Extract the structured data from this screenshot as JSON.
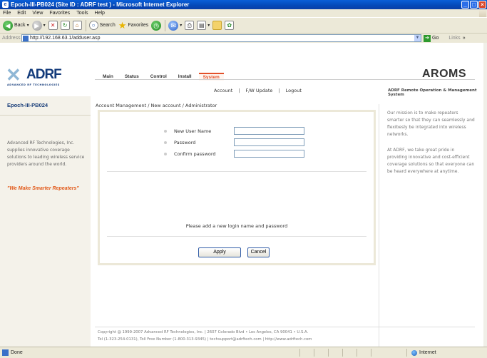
{
  "window": {
    "title": "Epoch-III-PB024 (Site ID : ADRF test ) - Microsoft Internet Explorer",
    "icon": "ie-icon"
  },
  "menu": [
    "File",
    "Edit",
    "View",
    "Favorites",
    "Tools",
    "Help"
  ],
  "toolbar": {
    "back": "Back",
    "search": "Search",
    "favorites": "Favorites"
  },
  "address": {
    "label": "Address",
    "url": "http://192.168.63.1/adduser.asp",
    "go": "Go",
    "links": "Links"
  },
  "logo": {
    "brand": "ADRF",
    "tagline": "ADVANCED RF TECHNOLOGIES"
  },
  "left": {
    "site": "Epoch-III-PB024",
    "description": "Advanced RF Technologies, Inc. supplies innovative coverage solutions to leading wireless service providers around the world.",
    "slogan": "\"We Make Smarter Repeaters\""
  },
  "tabs": [
    "Main",
    "Status",
    "Control",
    "Install",
    "System"
  ],
  "subnav": [
    "Account",
    "F/W Update",
    "Logout"
  ],
  "header": {
    "title": "AROMS",
    "subtitle": "ADRF Remote Operation & Management System"
  },
  "breadcrumb": "Account Management / New account / Administrator",
  "form": {
    "fields": [
      {
        "label": "New User Name",
        "value": ""
      },
      {
        "label": "Password",
        "value": ""
      },
      {
        "label": "Confirm password",
        "value": ""
      }
    ],
    "message": "Please add a new login name and password",
    "apply": "Apply",
    "cancel": "Cancel"
  },
  "right": {
    "p1": "Our mission is to make repeaters smarter so that they can seamlessly and flexibesly be integrated into wireless networks.",
    "p2": "At ADRF, we take great pride in providing innovative and cost-efficient coverage solutions so that everyone can be heard everywhere at anytime."
  },
  "footer": {
    "line1": "Copyright @ 1999-2007 Advanced RF Technologies, Inc. | 2607 Colorado Blvd • Los Angeles, CA 90041 • U.S.A.",
    "line2": "Tel (1-323-254-0131), Toll Free Number (1-800-313-9345) | techsupport@adrftech.com | http://www.adrftech.com"
  },
  "status": {
    "text": "Done",
    "zone": "Internet"
  },
  "colors": {
    "titlebar": "#0448b8",
    "accent": "#e2502a",
    "brand": "#123a7a"
  }
}
